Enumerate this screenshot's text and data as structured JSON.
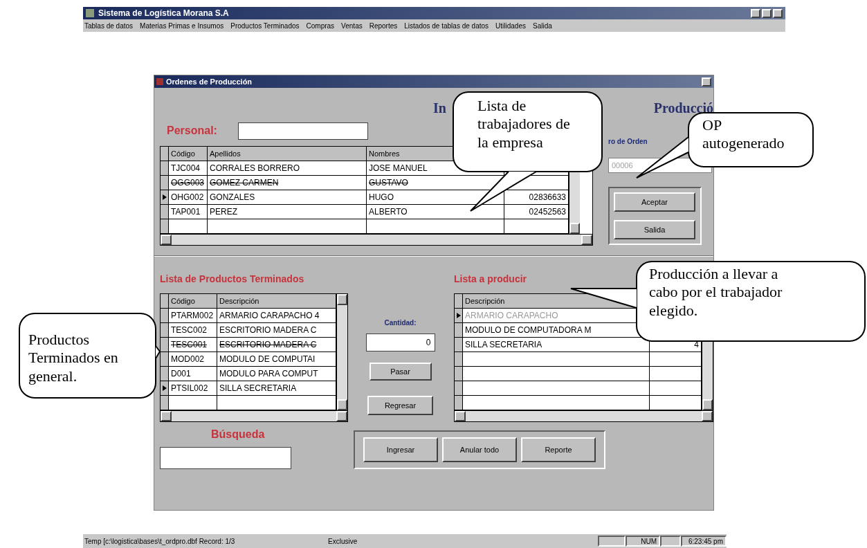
{
  "app": {
    "title": "Sistema de Logística Morana S.A",
    "menu": [
      "Tablas de datos",
      "Materias Primas e Insumos",
      "Productos Terminados",
      "Compras",
      "Ventas",
      "Reportes",
      "Listados de tablas de datos",
      "Utilidades",
      "Salida"
    ]
  },
  "dialog": {
    "title": "Ordenes de Producción",
    "heading_parts": [
      "In",
      "Producció"
    ],
    "personal_label": "Personal:",
    "order_number": {
      "label": "ro de Orden",
      "value": "00006"
    },
    "staff_table": {
      "columns": [
        "Código",
        "Apellidos",
        "Nombres"
      ],
      "rows": [
        {
          "cells": [
            "TJC004",
            "CORRALES BORRERO",
            "JOSE MANUEL"
          ],
          "selected": false,
          "deleted": false
        },
        {
          "cells": [
            "OGG003",
            "GOMEZ CARMEN",
            "GUSTAVO"
          ],
          "selected": false,
          "deleted": true
        },
        {
          "cells": [
            "OHG002",
            "GONZALES",
            "HUGO",
            "02836633"
          ],
          "selected": true,
          "deleted": false
        },
        {
          "cells": [
            "TAP001",
            "PEREZ",
            "ALBERTO",
            "02452563"
          ],
          "selected": false,
          "deleted": false
        }
      ]
    },
    "top_buttons": [
      "Aceptar",
      "Salida"
    ],
    "products_label": "Lista de Productos Terminados",
    "products_table": {
      "columns": [
        "Código",
        "Descripción"
      ],
      "rows": [
        {
          "cells": [
            "PTARM002",
            "ARMARIO CARAPACHO 4"
          ],
          "selected": false,
          "deleted": false
        },
        {
          "cells": [
            "TESC002",
            "ESCRITORIO MADERA C"
          ],
          "selected": false,
          "deleted": false
        },
        {
          "cells": [
            "TESC001",
            "ESCRITORIO MADERA C"
          ],
          "selected": false,
          "deleted": true
        },
        {
          "cells": [
            "MOD002",
            "MODULO DE COMPUTAI"
          ],
          "selected": false,
          "deleted": false
        },
        {
          "cells": [
            "D001",
            "MODULO PARA COMPUT"
          ],
          "selected": false,
          "deleted": false
        },
        {
          "cells": [
            "PTSIL002",
            "SILLA SECRETARIA"
          ],
          "selected": true,
          "deleted": false
        }
      ]
    },
    "quantity": {
      "label": "Cantidad:",
      "value": "0"
    },
    "move_buttons": [
      "Pasar",
      "Regresar"
    ],
    "produce_label": "Lista a producir",
    "produce_table": {
      "columns": [
        "Descripción"
      ],
      "rows": [
        {
          "cells": [
            "ARMARIO CARAPACHO"
          ],
          "selected": true,
          "deleted": false
        },
        {
          "cells": [
            "MODULO DE COMPUTADORA M"
          ],
          "selected": false,
          "deleted": false
        },
        {
          "cells": [
            "SILLA SECRETARIA",
            "4"
          ],
          "selected": false,
          "deleted": false
        }
      ]
    },
    "search_label": "Búsqueda",
    "bottom_buttons": [
      "Ingresar",
      "Anular todo",
      "Reporte"
    ]
  },
  "callouts": [
    {
      "text": "Lista de trabajadores de la empresa"
    },
    {
      "text": "OP autogenerado"
    },
    {
      "text": "Producción a llevar a cabo por el trabajador elegido."
    },
    {
      "text": "Productos Terminados en general."
    }
  ],
  "status_bar": [
    "Temp [c:\\logistica\\bases\\t_ordpro.dbf Record: 1/3",
    "Exclusive",
    "NUM",
    "6:23:45 pm"
  ]
}
